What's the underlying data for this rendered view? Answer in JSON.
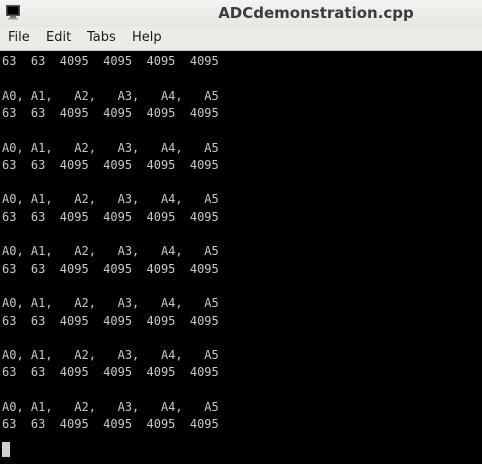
{
  "window": {
    "title": "ADCdemonstration.cpp"
  },
  "menu": [
    "File",
    "Edit",
    "Tabs",
    "Help"
  ],
  "terminal": {
    "lines": [
      "63  63  4095  4095  4095  4095",
      "",
      "A0, A1,   A2,   A3,   A4,   A5",
      "63  63  4095  4095  4095  4095",
      "",
      "A0, A1,   A2,   A3,   A4,   A5",
      "63  63  4095  4095  4095  4095",
      "",
      "A0, A1,   A2,   A3,   A4,   A5",
      "63  63  4095  4095  4095  4095",
      "",
      "A0, A1,   A2,   A3,   A4,   A5",
      "63  63  4095  4095  4095  4095",
      "",
      "A0, A1,   A2,   A3,   A4,   A5",
      "63  63  4095  4095  4095  4095",
      "",
      "A0, A1,   A2,   A3,   A4,   A5",
      "63  63  4095  4095  4095  4095",
      "",
      "A0, A1,   A2,   A3,   A4,   A5",
      "63  63  4095  4095  4095  4095"
    ]
  },
  "icons": {
    "app": "terminal-icon"
  }
}
